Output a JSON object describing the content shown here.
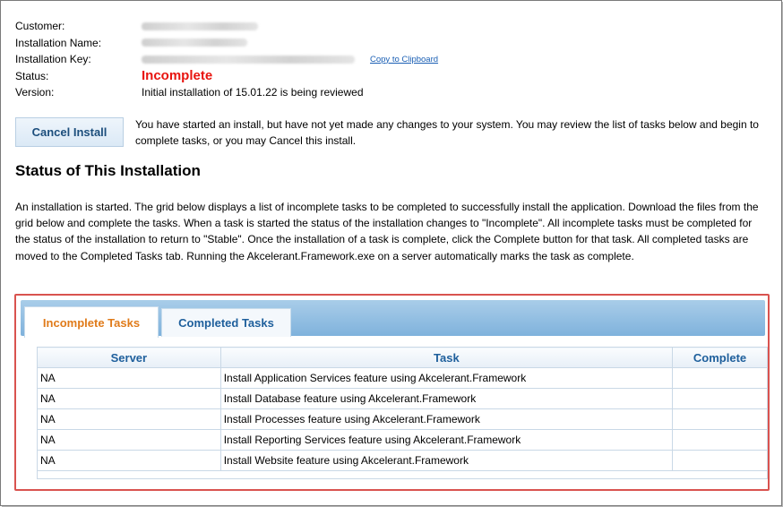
{
  "installation": {
    "labels": {
      "customer": "Customer:",
      "installation_name": "Installation Name:",
      "installation_key": "Installation Key:",
      "status": "Status:",
      "version": "Version:"
    },
    "status_value": "Incomplete",
    "version_value": "Initial installation of 15.01.22 is being reviewed",
    "copy_link": "Copy to Clipboard"
  },
  "actions": {
    "cancel_label": "Cancel Install",
    "intro_text": "You have started an install, but have not yet made any changes to your system. You may review the list of tasks below and begin to complete tasks, or you may Cancel this install."
  },
  "section": {
    "title": "Status of This Installation",
    "description": "An installation is started. The grid below displays a list of incomplete tasks to be completed to successfully install the application. Download the files from the grid below and complete the tasks. When a task is started the status of the installation changes to \"Incomplete\". All incomplete tasks must be completed for the status of the installation to return to \"Stable\". Once the installation of a task is complete, click the Complete button for that task. All completed tasks are moved to the Completed Tasks tab. Running the Akcelerant.Framework.exe on a server automatically marks the task as complete."
  },
  "tabs": [
    {
      "label": "Incomplete Tasks",
      "active": true
    },
    {
      "label": "Completed Tasks",
      "active": false
    }
  ],
  "grid": {
    "columns": [
      "Server",
      "Task",
      "Complete"
    ],
    "rows": [
      {
        "server": "NA",
        "task": "Install Application Services feature using Akcelerant.Framework",
        "complete": ""
      },
      {
        "server": "NA",
        "task": "Install Database feature using Akcelerant.Framework",
        "complete": ""
      },
      {
        "server": "NA",
        "task": "Install Processes feature using Akcelerant.Framework",
        "complete": ""
      },
      {
        "server": "NA",
        "task": "Install Reporting Services feature using Akcelerant.Framework",
        "complete": ""
      },
      {
        "server": "NA",
        "task": "Install Website feature using Akcelerant.Framework",
        "complete": ""
      }
    ]
  },
  "colors": {
    "status_incomplete": "#e8140f",
    "active_tab": "#e07b1a",
    "link_blue": "#1a5fb4",
    "panel_border": "#d9534f"
  }
}
